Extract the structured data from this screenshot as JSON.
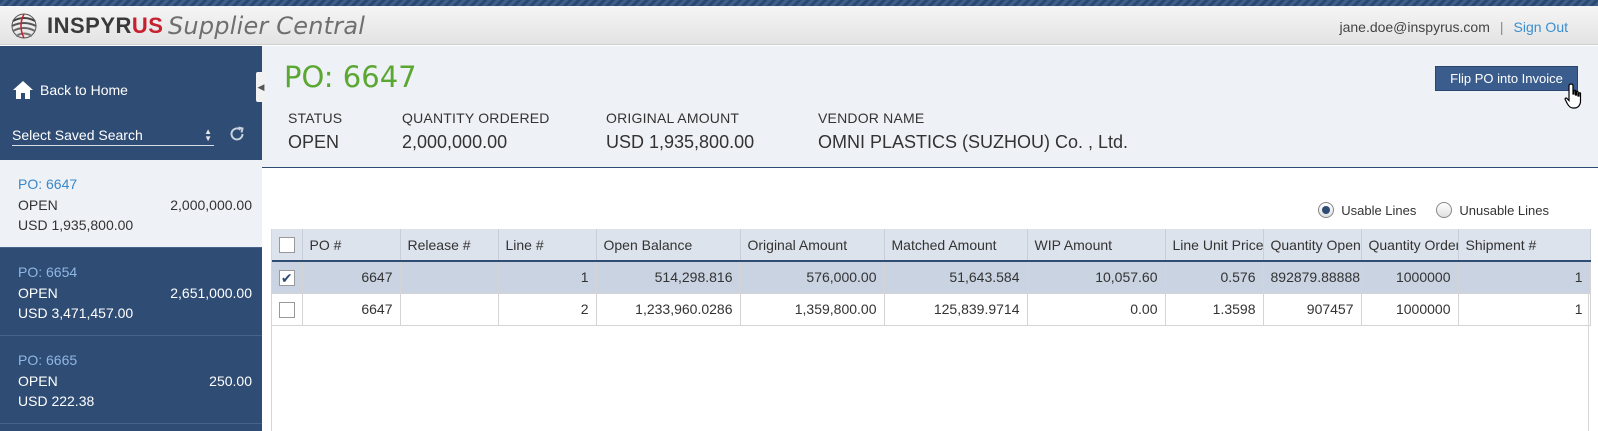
{
  "app": {
    "brand_main": "INSPYR",
    "brand_accent": "US",
    "product": "Supplier Central",
    "user_email": "jane.doe@inspyrus.com",
    "separator": "|",
    "sign_out": "Sign Out"
  },
  "sidebar": {
    "back_home": "Back to Home",
    "saved_search_placeholder": "Select Saved Search",
    "po_list": [
      {
        "title": "PO: 6647",
        "status": "OPEN",
        "quantity": "2,000,000.00",
        "amount": "USD 1,935,800.00",
        "active": true
      },
      {
        "title": "PO: 6654",
        "status": "OPEN",
        "quantity": "2,651,000.00",
        "amount": "USD 3,471,457.00",
        "active": false
      },
      {
        "title": "PO: 6665",
        "status": "OPEN",
        "quantity": "250.00",
        "amount": "USD 222.38",
        "active": false
      }
    ]
  },
  "po": {
    "title": "PO: 6647",
    "flip_button": "Flip PO into Invoice",
    "fields": {
      "status_label": "STATUS",
      "status_value": "OPEN",
      "qty_label": "QUANTITY ORDERED",
      "qty_value": "2,000,000.00",
      "amount_label": "ORIGINAL AMOUNT",
      "amount_value": "USD 1,935,800.00",
      "vendor_label": "VENDOR NAME",
      "vendor_value": "OMNI PLASTICS (SUZHOU) Co. , Ltd."
    }
  },
  "filters": {
    "usable": "Usable Lines",
    "unusable": "Unusable Lines",
    "selected": "usable"
  },
  "table": {
    "columns": [
      "PO #",
      "Release #",
      "Line #",
      "Open Balance",
      "Original Amount",
      "Matched Amount",
      "WIP Amount",
      "Line Unit Price",
      "Quantity Open",
      "Quantity Ordered",
      "Shipment #"
    ],
    "rows": [
      {
        "checked": true,
        "cells": [
          "6647",
          "",
          "1",
          "514,298.816",
          "576,000.00",
          "51,643.584",
          "10,057.60",
          "0.576",
          "892879.88888",
          "1000000",
          "1"
        ]
      },
      {
        "checked": false,
        "cells": [
          "6647",
          "",
          "2",
          "1,233,960.0286",
          "1,359,800.00",
          "125,839.9714",
          "0.00",
          "1.3598",
          "907457",
          "1000000",
          "1"
        ]
      }
    ]
  },
  "colors": {
    "sidebar_bg": "#2f4c74",
    "po_title_green": "#5aa832",
    "link_blue": "#3a8fd0",
    "brand_red": "#c8202f"
  },
  "icons": [
    "home-icon",
    "refresh-icon",
    "sort-arrows-icon",
    "collapse-arrow-icon",
    "hand-cursor-icon",
    "logo-globe-icon"
  ]
}
